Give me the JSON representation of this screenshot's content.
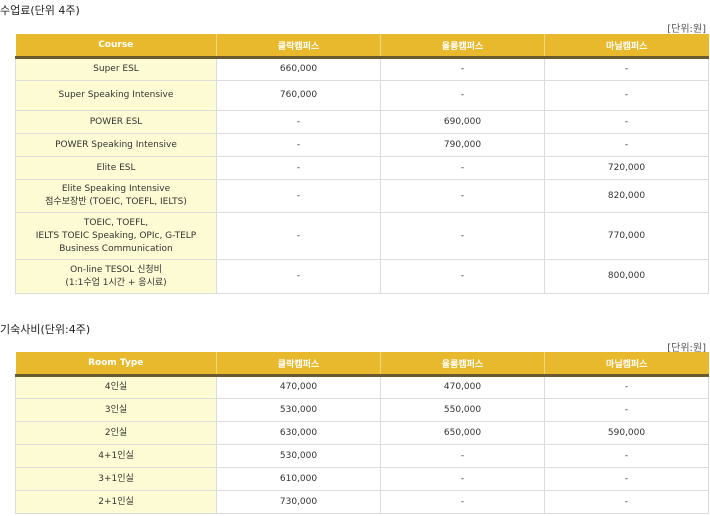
{
  "tuition": {
    "title": "수업료(단위 4주)",
    "unit": "[단위:원]",
    "headers": [
      "Course",
      "클락캠퍼스",
      "올롱캠퍼스",
      "마닐캠퍼스"
    ],
    "rows": [
      {
        "name": [
          "Super ESL"
        ],
        "v": [
          "660,000",
          "-",
          "-"
        ]
      },
      {
        "name": [
          "Super Speaking Intensive"
        ],
        "v": [
          "760,000",
          "-",
          "-"
        ]
      },
      {
        "name": [
          "POWER ESL"
        ],
        "v": [
          "-",
          "690,000",
          "-"
        ]
      },
      {
        "name": [
          "POWER Speaking Intensive"
        ],
        "v": [
          "-",
          "790,000",
          "-"
        ]
      },
      {
        "name": [
          "Elite ESL"
        ],
        "v": [
          "-",
          "-",
          "720,000"
        ]
      },
      {
        "name": [
          "Elite Speaking Intensive",
          "점수보장반 (TOEIC, TOEFL, IELTS)"
        ],
        "v": [
          "-",
          "-",
          "820,000"
        ]
      },
      {
        "name": [
          "TOEIC, TOEFL,",
          "IELTS TOEIC Speaking, OPIc, G-TELP",
          "Business Communication"
        ],
        "v": [
          "-",
          "-",
          "770,000"
        ]
      },
      {
        "name": [
          "On-line TESOL 신청비",
          "(1:1수업 1시간 + 응시료)"
        ],
        "v": [
          "-",
          "-",
          "800,000"
        ]
      }
    ]
  },
  "dorm": {
    "title": "기숙사비(단위:4주)",
    "unit": "[단위:원]",
    "headers": [
      "Room Type",
      "클락캠퍼스",
      "올롱캠퍼스",
      "마닐캠퍼스"
    ],
    "rows": [
      {
        "name": [
          "4인실"
        ],
        "v": [
          "470,000",
          "470,000",
          "-"
        ]
      },
      {
        "name": [
          "3인실"
        ],
        "v": [
          "530,000",
          "550,000",
          "-"
        ]
      },
      {
        "name": [
          "2인실"
        ],
        "v": [
          "630,000",
          "650,000",
          "590,000"
        ]
      },
      {
        "name": [
          "4+1인실"
        ],
        "v": [
          "530,000",
          "-",
          "-"
        ]
      },
      {
        "name": [
          "3+1인실"
        ],
        "v": [
          "610,000",
          "-",
          "-"
        ]
      },
      {
        "name": [
          "2+1인실"
        ],
        "v": [
          "730,000",
          "-",
          "-"
        ]
      }
    ]
  }
}
